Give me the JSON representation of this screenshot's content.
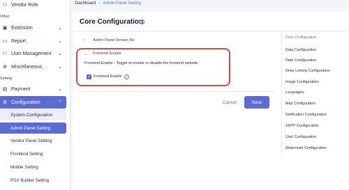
{
  "sidebar": {
    "top_item": {
      "label": "Vendor Role",
      "icon": "users-icon"
    },
    "section_other": "Other",
    "items": [
      {
        "label": "Extension",
        "icon": "extension-icon"
      },
      {
        "label": "Report",
        "icon": "file-icon"
      },
      {
        "label": "User Management",
        "icon": "users-icon"
      },
      {
        "label": "Miscellaneous",
        "icon": "plus-circle-icon"
      }
    ],
    "section_setting": "Setting",
    "payment": {
      "label": "Payment",
      "icon": "card-icon"
    },
    "configuration": {
      "label": "Configuration",
      "icon": "gear-icon"
    },
    "sub_items": [
      "System Configuration",
      "Admin Panel Setting",
      "Vendor Panel Setting",
      "Frontend Setting",
      "Mobile Setting",
      "PSX Builder Setting"
    ]
  },
  "breadcrumb": {
    "root": "Dashboard",
    "current": "Admin Panel Setting"
  },
  "main": {
    "title": "Core Configuration",
    "accordion": {
      "collapsed_label": "Admin Panel Version No",
      "expanded_label": "Frontend Enable",
      "description": "Frontend Enable - Toggle to enable or disable the frontend website.",
      "checkbox_label": "Frontend Enable",
      "checkbox_checked": true
    },
    "cancel_label": "Cancel",
    "save_label": "Save"
  },
  "right_nav": [
    "Core Configuration",
    "Data Configuration",
    "Date Configuration",
    "Deep Linking Configuration",
    "Image Configuration",
    "Languages",
    "Map Configuration",
    "Notification Configuration",
    "SMTP Configuration",
    "User Configuration",
    "Watermark Configuration"
  ],
  "colors": {
    "accent": "#5b6bd5",
    "highlight": "#d94646"
  }
}
